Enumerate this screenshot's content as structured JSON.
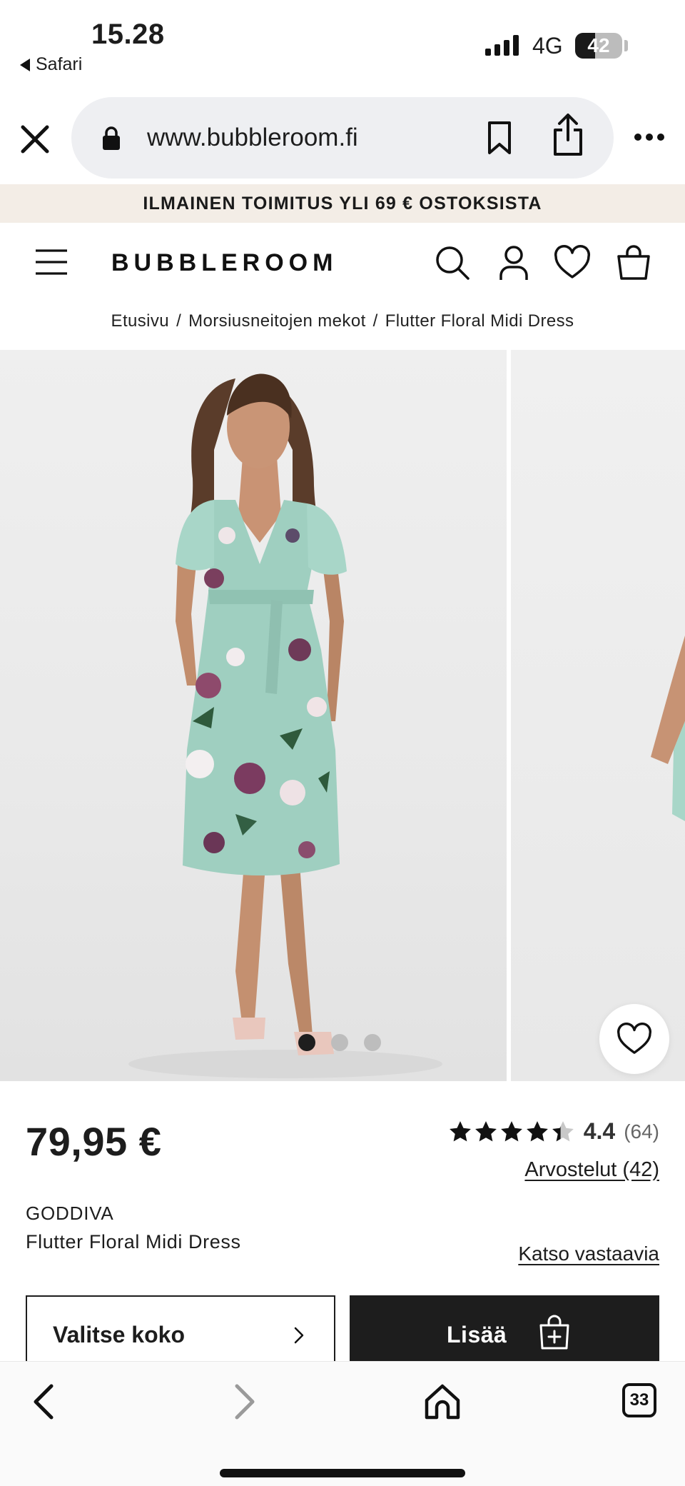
{
  "status_bar": {
    "time": "15.28",
    "back_app": "Safari",
    "network": "4G",
    "battery": "42",
    "battery_level": 0.42
  },
  "browser": {
    "url": "www.bubbleroom.fi",
    "open_tabs": "33",
    "icons": [
      "close-icon",
      "lock-icon",
      "bookmark-icon",
      "share-icon",
      "more-icon",
      "back-icon",
      "forward-icon",
      "home-icon",
      "tabs-icon"
    ]
  },
  "promo": {
    "text": "ILMAINEN TOIMITUS YLI 69 € OSTOKSISTA"
  },
  "header": {
    "logo": "BUBBLEROOM",
    "icons": [
      "menu-icon",
      "search-icon",
      "account-icon",
      "wishlist-icon",
      "cart-icon"
    ]
  },
  "breadcrumb": {
    "items": [
      "Etusivu",
      "Morsiusneitojen mekot",
      "Flutter Floral Midi Dress"
    ],
    "separator": "/"
  },
  "gallery": {
    "image_count": 3,
    "active_index": 0
  },
  "product": {
    "price": "79,95 €",
    "rating_value": "4.4",
    "rating_count": "(64)",
    "stars": 4.4,
    "reviews_link": "Arvostelut (42)",
    "brand": "GODDIVA",
    "name": "Flutter Floral Midi Dress",
    "similar_link": "Katso vastaavia"
  },
  "actions": {
    "size_label": "Valitse koko",
    "add_label": "Lisää"
  },
  "colors": {
    "promo_bg": "#f3ede6",
    "primary_dark": "#1d1d1d",
    "dress_green": "#9fcfc0",
    "url_pill_bg": "#eeeff2"
  }
}
